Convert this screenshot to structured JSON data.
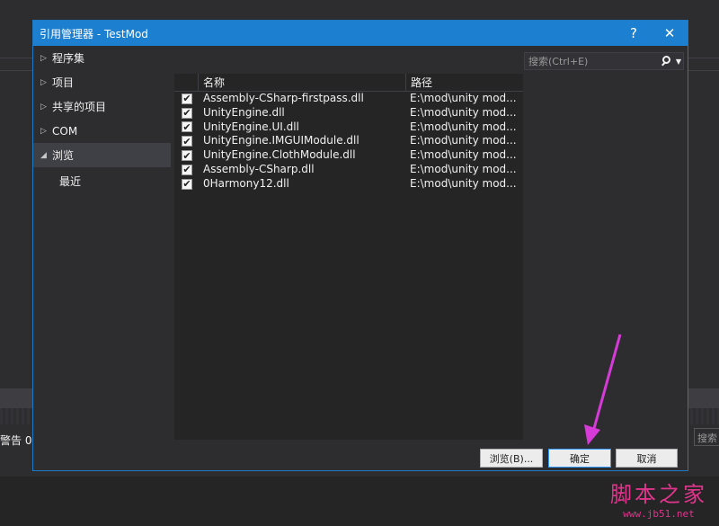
{
  "background": {
    "status_text": "警告 0",
    "search_text": "搜索解"
  },
  "dialog": {
    "title": "引用管理器 - TestMod",
    "help_label": "?",
    "close_label": "✕"
  },
  "nav": {
    "items": [
      {
        "label": "程序集",
        "expanded": false
      },
      {
        "label": "项目",
        "expanded": false
      },
      {
        "label": "共享的项目",
        "expanded": false
      },
      {
        "label": "COM",
        "expanded": false
      },
      {
        "label": "浏览",
        "expanded": true
      },
      {
        "label": "最近"
      }
    ]
  },
  "search": {
    "placeholder": "搜索(Ctrl+E)"
  },
  "grid": {
    "headers": {
      "name": "名称",
      "path": "路径"
    },
    "rows": [
      {
        "checked": true,
        "name": "Assembly-CSharp-firstpass.dll",
        "path": "E:\\mod\\unity mod..."
      },
      {
        "checked": true,
        "name": "UnityEngine.dll",
        "path": "E:\\mod\\unity mod..."
      },
      {
        "checked": true,
        "name": "UnityEngine.UI.dll",
        "path": "E:\\mod\\unity mod..."
      },
      {
        "checked": true,
        "name": "UnityEngine.IMGUIModule.dll",
        "path": "E:\\mod\\unity mod..."
      },
      {
        "checked": true,
        "name": "UnityEngine.ClothModule.dll",
        "path": "E:\\mod\\unity mod..."
      },
      {
        "checked": true,
        "name": "Assembly-CSharp.dll",
        "path": "E:\\mod\\unity mod..."
      },
      {
        "checked": true,
        "name": "0Harmony12.dll",
        "path": "E:\\mod\\unity mod..."
      }
    ]
  },
  "buttons": {
    "browse": "浏览(B)...",
    "ok": "确定",
    "cancel": "取消"
  },
  "watermark": {
    "big": "脚本之家",
    "small": "www.jb51.net"
  },
  "colors": {
    "title_bar": "#1d7fd0",
    "annotation_arrow": "#d63bd8",
    "watermark": "#e0358c"
  }
}
